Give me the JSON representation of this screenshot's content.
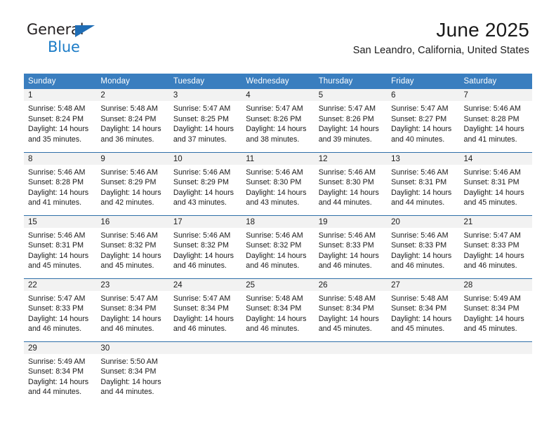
{
  "brand": {
    "name_part1": "General",
    "name_part2": "Blue",
    "triangle_color": "#1f6db5",
    "blue_color": "#1c7cc7"
  },
  "header": {
    "title": "June 2025",
    "subtitle": "San Leandro, California, United States"
  },
  "theme": {
    "header_row_bg": "#3a7ebf",
    "header_row_text": "#ffffff",
    "daynum_band_bg": "#f2f2f2",
    "week_separator": "#2f6fa8",
    "page_bg": "#ffffff",
    "body_text": "#1a1a1a"
  },
  "calendar": {
    "weekday_headers": [
      "Sunday",
      "Monday",
      "Tuesday",
      "Wednesday",
      "Thursday",
      "Friday",
      "Saturday"
    ],
    "weeks": [
      [
        {
          "day": "1",
          "sunrise": "Sunrise: 5:48 AM",
          "sunset": "Sunset: 8:24 PM",
          "daylight": "Daylight: 14 hours and 35 minutes."
        },
        {
          "day": "2",
          "sunrise": "Sunrise: 5:48 AM",
          "sunset": "Sunset: 8:24 PM",
          "daylight": "Daylight: 14 hours and 36 minutes."
        },
        {
          "day": "3",
          "sunrise": "Sunrise: 5:47 AM",
          "sunset": "Sunset: 8:25 PM",
          "daylight": "Daylight: 14 hours and 37 minutes."
        },
        {
          "day": "4",
          "sunrise": "Sunrise: 5:47 AM",
          "sunset": "Sunset: 8:26 PM",
          "daylight": "Daylight: 14 hours and 38 minutes."
        },
        {
          "day": "5",
          "sunrise": "Sunrise: 5:47 AM",
          "sunset": "Sunset: 8:26 PM",
          "daylight": "Daylight: 14 hours and 39 minutes."
        },
        {
          "day": "6",
          "sunrise": "Sunrise: 5:47 AM",
          "sunset": "Sunset: 8:27 PM",
          "daylight": "Daylight: 14 hours and 40 minutes."
        },
        {
          "day": "7",
          "sunrise": "Sunrise: 5:46 AM",
          "sunset": "Sunset: 8:28 PM",
          "daylight": "Daylight: 14 hours and 41 minutes."
        }
      ],
      [
        {
          "day": "8",
          "sunrise": "Sunrise: 5:46 AM",
          "sunset": "Sunset: 8:28 PM",
          "daylight": "Daylight: 14 hours and 41 minutes."
        },
        {
          "day": "9",
          "sunrise": "Sunrise: 5:46 AM",
          "sunset": "Sunset: 8:29 PM",
          "daylight": "Daylight: 14 hours and 42 minutes."
        },
        {
          "day": "10",
          "sunrise": "Sunrise: 5:46 AM",
          "sunset": "Sunset: 8:29 PM",
          "daylight": "Daylight: 14 hours and 43 minutes."
        },
        {
          "day": "11",
          "sunrise": "Sunrise: 5:46 AM",
          "sunset": "Sunset: 8:30 PM",
          "daylight": "Daylight: 14 hours and 43 minutes."
        },
        {
          "day": "12",
          "sunrise": "Sunrise: 5:46 AM",
          "sunset": "Sunset: 8:30 PM",
          "daylight": "Daylight: 14 hours and 44 minutes."
        },
        {
          "day": "13",
          "sunrise": "Sunrise: 5:46 AM",
          "sunset": "Sunset: 8:31 PM",
          "daylight": "Daylight: 14 hours and 44 minutes."
        },
        {
          "day": "14",
          "sunrise": "Sunrise: 5:46 AM",
          "sunset": "Sunset: 8:31 PM",
          "daylight": "Daylight: 14 hours and 45 minutes."
        }
      ],
      [
        {
          "day": "15",
          "sunrise": "Sunrise: 5:46 AM",
          "sunset": "Sunset: 8:31 PM",
          "daylight": "Daylight: 14 hours and 45 minutes."
        },
        {
          "day": "16",
          "sunrise": "Sunrise: 5:46 AM",
          "sunset": "Sunset: 8:32 PM",
          "daylight": "Daylight: 14 hours and 45 minutes."
        },
        {
          "day": "17",
          "sunrise": "Sunrise: 5:46 AM",
          "sunset": "Sunset: 8:32 PM",
          "daylight": "Daylight: 14 hours and 46 minutes."
        },
        {
          "day": "18",
          "sunrise": "Sunrise: 5:46 AM",
          "sunset": "Sunset: 8:32 PM",
          "daylight": "Daylight: 14 hours and 46 minutes."
        },
        {
          "day": "19",
          "sunrise": "Sunrise: 5:46 AM",
          "sunset": "Sunset: 8:33 PM",
          "daylight": "Daylight: 14 hours and 46 minutes."
        },
        {
          "day": "20",
          "sunrise": "Sunrise: 5:46 AM",
          "sunset": "Sunset: 8:33 PM",
          "daylight": "Daylight: 14 hours and 46 minutes."
        },
        {
          "day": "21",
          "sunrise": "Sunrise: 5:47 AM",
          "sunset": "Sunset: 8:33 PM",
          "daylight": "Daylight: 14 hours and 46 minutes."
        }
      ],
      [
        {
          "day": "22",
          "sunrise": "Sunrise: 5:47 AM",
          "sunset": "Sunset: 8:33 PM",
          "daylight": "Daylight: 14 hours and 46 minutes."
        },
        {
          "day": "23",
          "sunrise": "Sunrise: 5:47 AM",
          "sunset": "Sunset: 8:34 PM",
          "daylight": "Daylight: 14 hours and 46 minutes."
        },
        {
          "day": "24",
          "sunrise": "Sunrise: 5:47 AM",
          "sunset": "Sunset: 8:34 PM",
          "daylight": "Daylight: 14 hours and 46 minutes."
        },
        {
          "day": "25",
          "sunrise": "Sunrise: 5:48 AM",
          "sunset": "Sunset: 8:34 PM",
          "daylight": "Daylight: 14 hours and 46 minutes."
        },
        {
          "day": "26",
          "sunrise": "Sunrise: 5:48 AM",
          "sunset": "Sunset: 8:34 PM",
          "daylight": "Daylight: 14 hours and 45 minutes."
        },
        {
          "day": "27",
          "sunrise": "Sunrise: 5:48 AM",
          "sunset": "Sunset: 8:34 PM",
          "daylight": "Daylight: 14 hours and 45 minutes."
        },
        {
          "day": "28",
          "sunrise": "Sunrise: 5:49 AM",
          "sunset": "Sunset: 8:34 PM",
          "daylight": "Daylight: 14 hours and 45 minutes."
        }
      ],
      [
        {
          "day": "29",
          "sunrise": "Sunrise: 5:49 AM",
          "sunset": "Sunset: 8:34 PM",
          "daylight": "Daylight: 14 hours and 44 minutes."
        },
        {
          "day": "30",
          "sunrise": "Sunrise: 5:50 AM",
          "sunset": "Sunset: 8:34 PM",
          "daylight": "Daylight: 14 hours and 44 minutes."
        },
        {
          "day": "",
          "sunrise": "",
          "sunset": "",
          "daylight": ""
        },
        {
          "day": "",
          "sunrise": "",
          "sunset": "",
          "daylight": ""
        },
        {
          "day": "",
          "sunrise": "",
          "sunset": "",
          "daylight": ""
        },
        {
          "day": "",
          "sunrise": "",
          "sunset": "",
          "daylight": ""
        },
        {
          "day": "",
          "sunrise": "",
          "sunset": "",
          "daylight": ""
        }
      ]
    ]
  }
}
